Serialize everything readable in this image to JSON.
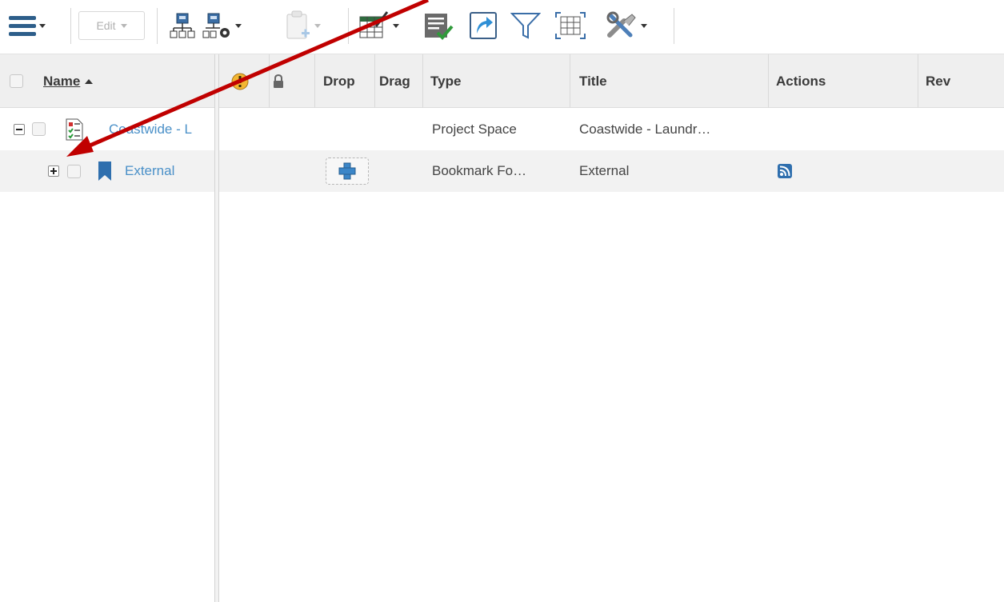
{
  "toolbar": {
    "edit_label": "Edit",
    "icons": [
      "menu-icon",
      "structure-icon",
      "structure-settings-icon",
      "paste-icon",
      "table-edit-icon",
      "checklist-icon",
      "open-link-icon",
      "filter-icon",
      "fit-columns-icon",
      "tools-icon"
    ]
  },
  "grid": {
    "columns": {
      "name": "Name",
      "drop": "Drop",
      "drag": "Drag",
      "type": "Type",
      "title": "Title",
      "actions": "Actions",
      "rev": "Rev"
    },
    "rows": [
      {
        "name": "Coastwide - L",
        "type": "Project Space",
        "title": "Coastwide - Laundr…",
        "expanded": true
      },
      {
        "name": "External",
        "type": "Bookmark Fo…",
        "title": "External",
        "expanded": false
      }
    ]
  },
  "colors": {
    "link": "#4a90c8",
    "arrow": "#c00000",
    "header_bg": "#efefef",
    "selected_row_bg": "#f2f2f2"
  }
}
